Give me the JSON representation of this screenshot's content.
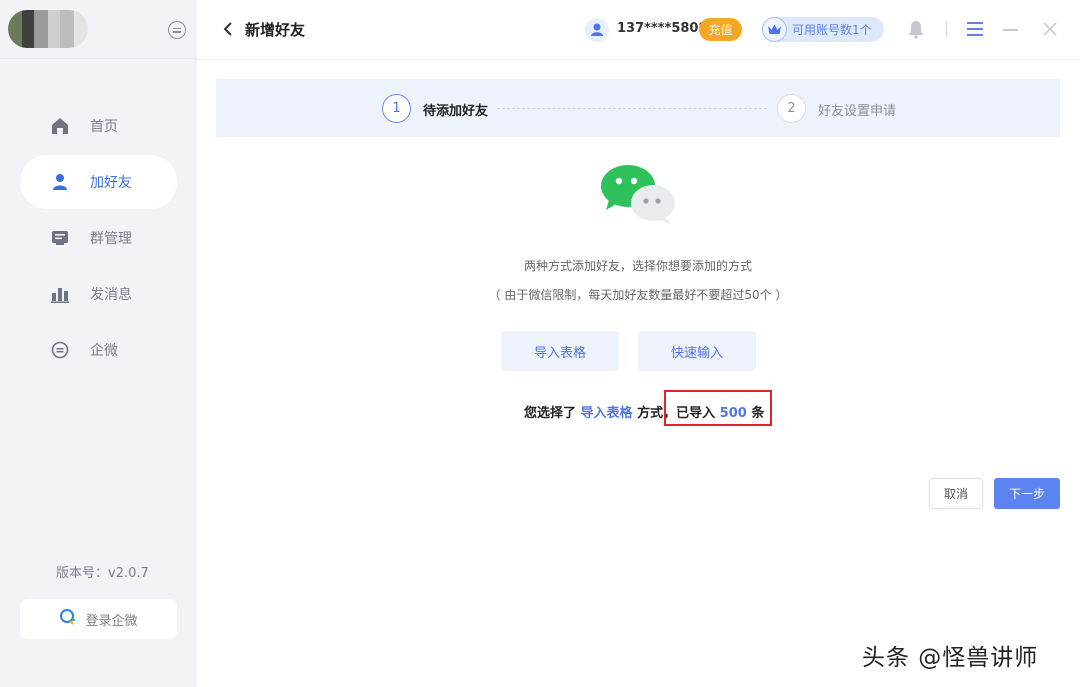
{
  "sidebar": {
    "items": [
      {
        "label": "首页",
        "icon": "home-icon"
      },
      {
        "label": "加好友",
        "icon": "user-icon"
      },
      {
        "label": "群管理",
        "icon": "group-manage-icon"
      },
      {
        "label": "发消息",
        "icon": "send-message-icon"
      },
      {
        "label": "企微",
        "icon": "wecom-chat-icon"
      }
    ],
    "active_index": 1,
    "version": "版本号：v2.0.7",
    "login_wecom_label": "登录企微"
  },
  "header": {
    "title": "新增好友",
    "phone": "137****5808",
    "recharge_label": "充值",
    "accounts_label": "可用账号数1个"
  },
  "steps": [
    {
      "number": "1",
      "label": "待添加好友"
    },
    {
      "number": "2",
      "label": "好友设置申请"
    }
  ],
  "main": {
    "description": "两种方式添加好友，选择你想要添加的方式",
    "note": "（ 由于微信限制，每天加好友数量最好不要超过50个 ）",
    "import_button": "导入表格",
    "quick_input_button": "快速输入",
    "selection_prefix": "您选择了",
    "selection_method": "导入表格",
    "selection_mid": "方式，",
    "imported_prefix": "已导入",
    "imported_count": "500",
    "imported_suffix": "条"
  },
  "footer": {
    "cancel_label": "取消",
    "next_label": "下一步"
  },
  "watermark": "头条 @怪兽讲师",
  "colors": {
    "accent": "#4f74e8",
    "recharge": "#f5a623",
    "highlight": "#e0262a",
    "sidebar_bg": "#f1f3f7"
  }
}
